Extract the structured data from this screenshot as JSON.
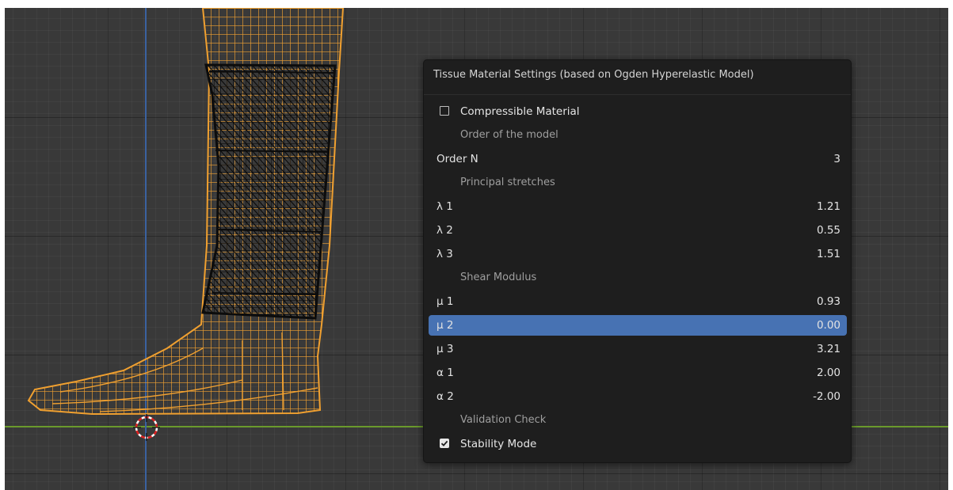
{
  "panel": {
    "title": "Tissue Material Settings (based on Ogden Hyperelastic Model)",
    "compressible": {
      "label": "Compressible Material",
      "checked": false
    },
    "order_header": "Order of the model",
    "order": {
      "label": "Order N",
      "value": "3"
    },
    "stretches_header": "Principal stretches",
    "lambda1": {
      "label": "λ 1",
      "value": "1.21"
    },
    "lambda2": {
      "label": "λ 2",
      "value": "0.55"
    },
    "lambda3": {
      "label": "λ 3",
      "value": "1.51"
    },
    "shear_header": "Shear Modulus",
    "mu1": {
      "label": "μ 1",
      "value": "0.93"
    },
    "mu2": {
      "label": "μ 2",
      "value": "0.00"
    },
    "mu3": {
      "label": "μ 3",
      "value": "3.21"
    },
    "alpha1": {
      "label": "α 1",
      "value": "2.00"
    },
    "alpha2": {
      "label": "α 2",
      "value": "-2.00"
    },
    "validation_header": "Validation Check",
    "stability": {
      "label": "Stability Mode",
      "checked": true
    }
  },
  "colors": {
    "viewport_bg": "#393939",
    "mesh_orange": "#f0a030",
    "sleeve_black": "#0c0c0c",
    "x_axis": "#6a9a2c",
    "y_axis": "#3a62a0",
    "selection": "#4772b3"
  }
}
